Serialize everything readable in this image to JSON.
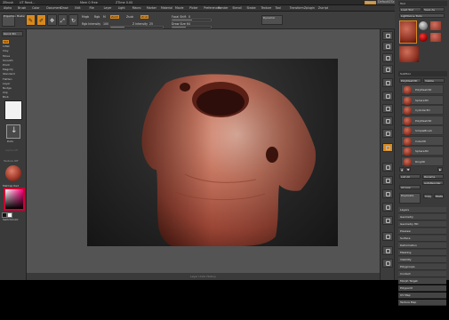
{
  "titlebar": {
    "app": "ZBrush",
    "doc": "UT Rend...",
    "mem": "Mem 0 Free",
    "timer": "ZTime 0.00",
    "right_buttons": [
      "Menus",
      "DefaultZScript",
      "Help"
    ]
  },
  "menubar": {
    "items": [
      "Alpha",
      "Brush",
      "Color",
      "Document",
      "Draw",
      "Edit",
      "File",
      "Layer",
      "Light",
      "Macro",
      "Marker",
      "Material",
      "Movie",
      "Picker",
      "Preferences",
      "Render",
      "Stencil",
      "Stroke",
      "Texture",
      "Tool",
      "Transform",
      "Zplugin",
      "Zscript"
    ]
  },
  "toolbar": {
    "projection_label": "Projection Master",
    "edit_label": "Edit",
    "draw_label": "Draw",
    "move_label": "Move",
    "scale_label": "Scale",
    "rotate_label": "Rotate",
    "mrgb": "Mrgb",
    "rgb": "Rgb",
    "m": "M",
    "zadd": "Zadd",
    "zsub": "Zsub",
    "zcut": "Zcut",
    "rgb_intensity_label": "Rgb Intensity",
    "rgb_intensity_value": 100,
    "z_intensity_label": "Z Intensity",
    "z_intensity_value": 25,
    "focal_shift_label": "Focal Shift",
    "focal_shift_value": 0,
    "draw_size_label": "Draw Size",
    "draw_size_value": 64,
    "dynamic_label": "Dynamic"
  },
  "leftshelf": {
    "top_label": "Quick 3D",
    "items": [
      "Std",
      "Inflat",
      "Clay",
      "Move",
      "Smooth",
      "Pinch",
      "Magnify",
      "Standard",
      "Flatten",
      "Layer",
      "Nudge",
      "Clip",
      "Blob"
    ],
    "stroke_label": "Dots",
    "alpha_label": "Alpha Off",
    "texture_label": "Texture Off",
    "material_label": "MatCap Red",
    "gradient_label": "Gradient",
    "switch_color_label": "SwitchColor",
    "alternate_label": "Alternate"
  },
  "righttools": {
    "buttons": [
      "BPR",
      "SPix",
      "Scroll",
      "Zoom",
      "Actual",
      "AAHalf",
      "Persp",
      "Floor",
      "Local",
      "LSym",
      "Xyz",
      "Frame",
      "Move",
      "Scale",
      "Rotate",
      "PolyF",
      "Transp",
      "Ghost",
      "Solo",
      "Xpose"
    ]
  },
  "rightpanel": {
    "header": "Tool",
    "load_tool": "Load Tool",
    "save_as": "Save As",
    "copy_tool": "Copy Tool",
    "paste_tool": "Paste Tool",
    "import": "Import",
    "export": "Export",
    "clone": "Clone",
    "make_polymesh": "Make PolyMesh3D",
    "goz": "GoZ",
    "all": "All",
    "visible": "Visible",
    "r_label": "R",
    "lightbox_tools": "Lightbox ▸ Tools",
    "current_tool": "PolyMesh3D",
    "subtool_header": "SubTool",
    "subtools": [
      {
        "name": "PolyMesh3D"
      },
      {
        "name": "Sphere3D"
      },
      {
        "name": "Cylinder3D"
      },
      {
        "name": "PolyMesh3D"
      },
      {
        "name": "SimpleBrush"
      },
      {
        "name": "Cube3D"
      },
      {
        "name": "Sphere3D"
      },
      {
        "name": "Ring3D"
      }
    ],
    "list_all": "List All",
    "rename": "Rename",
    "auto_reorder": "AutoReorder",
    "all_low": "All Low",
    "all_high": "All High",
    "copy": "Copy",
    "paste": "Paste",
    "duplicate": "Duplicate",
    "append": "Append",
    "insert": "Insert",
    "delete": "Delete",
    "del_other": "Del Other",
    "del_all": "Del All",
    "menu_items": [
      "Layers",
      "Geometry",
      "Geometry HD",
      "Preview",
      "Surface",
      "Deformation",
      "Masking",
      "Visibility",
      "Polygroups",
      "Contact",
      "Morph Target",
      "Polypaint",
      "UV Map",
      "Texture Map"
    ]
  },
  "statusbar": {
    "text": "Layer Undo History"
  },
  "colors": {
    "accent": "#d9891c",
    "clay": "#b55a45"
  }
}
